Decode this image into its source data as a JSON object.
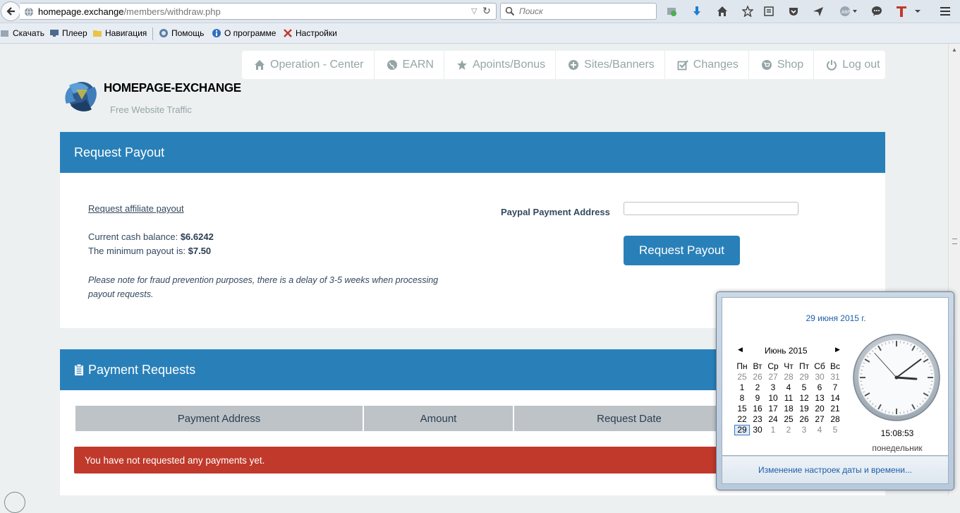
{
  "browser": {
    "url_host": "homepage.exchange",
    "url_path": "/members/withdraw.php",
    "search_placeholder": "Поиск",
    "bookmarks": [
      "Скачать",
      "Плеер",
      "Навигация",
      "Помощь",
      "О программе",
      "Настройки"
    ]
  },
  "nav": {
    "items": [
      {
        "label": "Operation - Center",
        "icon": "home-icon"
      },
      {
        "label": "EARN",
        "icon": "globe-icon"
      },
      {
        "label": "Apoints/Bonus",
        "icon": "star-icon"
      },
      {
        "label": "Sites/Banners",
        "icon": "plus-circle-icon"
      },
      {
        "label": "Changes",
        "icon": "check-square-icon"
      },
      {
        "label": "Shop",
        "icon": "cart-icon"
      },
      {
        "label": "Log out",
        "icon": "power-icon"
      }
    ]
  },
  "brand": {
    "name": "HOMEPAGE-EXCHANGE",
    "tagline": "Free Website Traffic"
  },
  "payout": {
    "title": "Request Payout",
    "affiliate_link": "Request affiliate payout",
    "balance_label": "Current cash balance:",
    "balance_value": "$6.6242",
    "minimum_label": "The minimum payout is:",
    "minimum_value": "$7.50",
    "note": "Please note for fraud prevention purposes, there is a delay of 3-5 weeks when processing payout requests.",
    "paypal_label": "Paypal Payment Address",
    "paypal_value": "",
    "button_label": "Request Payout"
  },
  "requests": {
    "title": "Payment Requests",
    "columns": [
      "Payment Address",
      "Amount",
      "Request Date"
    ],
    "empty_message": "You have not requested any payments yet."
  },
  "clock": {
    "full_date": "29 июня 2015 г.",
    "month_label": "Июнь 2015",
    "weekdays": [
      "Пн",
      "Вт",
      "Ср",
      "Чт",
      "Пт",
      "Сб",
      "Вс"
    ],
    "weeks": [
      [
        "25",
        "26",
        "27",
        "28",
        "29",
        "30",
        "31"
      ],
      [
        "1",
        "2",
        "3",
        "4",
        "5",
        "6",
        "7"
      ],
      [
        "8",
        "9",
        "10",
        "11",
        "12",
        "13",
        "14"
      ],
      [
        "15",
        "16",
        "17",
        "18",
        "19",
        "20",
        "21"
      ],
      [
        "22",
        "23",
        "24",
        "25",
        "26",
        "27",
        "28"
      ],
      [
        "29",
        "30",
        "1",
        "2",
        "3",
        "4",
        "5"
      ]
    ],
    "today": "29",
    "time": "15:08:53",
    "weekday": "понедельник",
    "settings_link": "Изменение настроек даты и времени..."
  },
  "colors": {
    "primary": "#2980b9",
    "danger": "#c0392b",
    "page_bg": "#ecf0f1",
    "table_header": "#bdc3c7"
  }
}
